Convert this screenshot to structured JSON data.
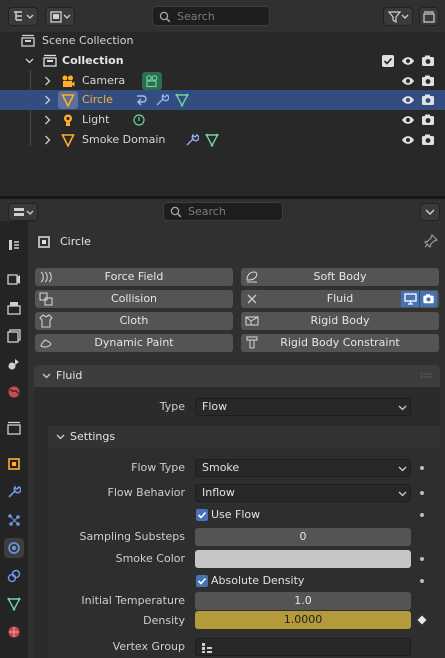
{
  "outliner": {
    "search_placeholder": "Search",
    "rows": [
      {
        "label": "Scene Collection"
      },
      {
        "label": "Collection"
      },
      {
        "label": "Camera"
      },
      {
        "label": "Circle"
      },
      {
        "label": "Light"
      },
      {
        "label": "Smoke Domain"
      }
    ]
  },
  "properties": {
    "search_placeholder": "Search",
    "object_name": "Circle",
    "physics_buttons": [
      {
        "label": "Force Field"
      },
      {
        "label": "Soft Body"
      },
      {
        "label": "Collision"
      },
      {
        "label": "Fluid"
      },
      {
        "label": "Cloth"
      },
      {
        "label": "Rigid Body"
      },
      {
        "label": "Dynamic Paint"
      },
      {
        "label": "Rigid Body Constraint"
      }
    ],
    "fluid_panel": {
      "title": "Fluid",
      "type_label": "Type",
      "type_value": "Flow",
      "settings_title": "Settings",
      "flow_type_label": "Flow Type",
      "flow_type_value": "Smoke",
      "flow_behavior_label": "Flow Behavior",
      "flow_behavior_value": "Inflow",
      "use_flow_label": "Use Flow",
      "use_flow_checked": true,
      "sampling_label": "Sampling Substeps",
      "sampling_value": "0",
      "smoke_color_label": "Smoke Color",
      "smoke_color": "#c5c5c5",
      "absolute_density_label": "Absolute Density",
      "absolute_density_checked": true,
      "initial_temp_label": "Initial Temperature",
      "initial_temp_value": "1.0",
      "density_label": "Density",
      "density_value": "1.0000",
      "vertex_group_label": "Vertex Group"
    }
  },
  "colors": {
    "selected_row": "#334d80",
    "active_object_text": "#ffaf29",
    "keyframed_field": "#b59a3b",
    "checkbox": "#4772b3",
    "fluid_toggle": "#4772b3"
  }
}
